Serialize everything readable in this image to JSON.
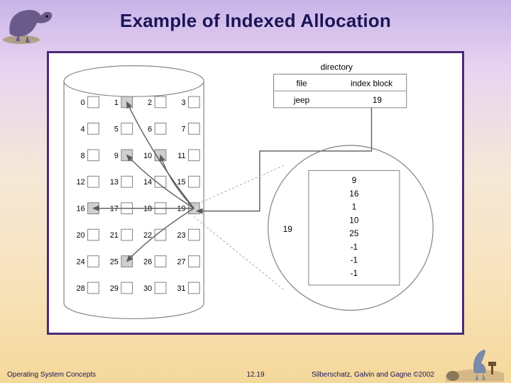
{
  "title": "Example of Indexed Allocation",
  "footer": {
    "left": "Operating System Concepts",
    "center": "12.19",
    "right": "Silberschatz, Galvin and Gagne ©2002"
  },
  "diagram": {
    "directory_label": "directory",
    "dir_headers": {
      "file": "file",
      "index": "index block"
    },
    "dir_entry": {
      "file": "jeep",
      "index_block": "19"
    },
    "index_block_pointer_label": "19",
    "index_block_contents": [
      "9",
      "16",
      "1",
      "10",
      "25",
      "-1",
      "-1",
      "-1"
    ],
    "disk_rows": [
      {
        "labels": [
          "0",
          "1",
          "2",
          "3"
        ],
        "shaded": [
          false,
          true,
          false,
          false
        ]
      },
      {
        "labels": [
          "4",
          "5",
          "6",
          "7"
        ],
        "shaded": [
          false,
          false,
          false,
          false
        ]
      },
      {
        "labels": [
          "8",
          "9",
          "10",
          "11"
        ],
        "shaded": [
          false,
          true,
          true,
          false
        ]
      },
      {
        "labels": [
          "12",
          "13",
          "14",
          "15"
        ],
        "shaded": [
          false,
          false,
          false,
          false
        ]
      },
      {
        "labels": [
          "16",
          "17",
          "18",
          "19"
        ],
        "shaded": [
          true,
          false,
          false,
          true
        ]
      },
      {
        "labels": [
          "20",
          "21",
          "22",
          "23"
        ],
        "shaded": [
          false,
          false,
          false,
          false
        ]
      },
      {
        "labels": [
          "24",
          "25",
          "26",
          "27"
        ],
        "shaded": [
          false,
          true,
          false,
          false
        ]
      },
      {
        "labels": [
          "28",
          "29",
          "30",
          "31"
        ],
        "shaded": [
          false,
          false,
          false,
          false
        ]
      }
    ]
  },
  "chart_data": {
    "type": "diagram",
    "title": "Example of Indexed Allocation",
    "directory": [
      {
        "file": "jeep",
        "index_block": 19
      }
    ],
    "index_block": {
      "block_number": 19,
      "pointers": [
        9,
        16,
        1,
        10,
        25,
        -1,
        -1,
        -1
      ]
    },
    "disk_blocks_total": 32,
    "allocated_blocks": [
      1,
      9,
      10,
      16,
      25
    ],
    "index_block_number": 19
  }
}
